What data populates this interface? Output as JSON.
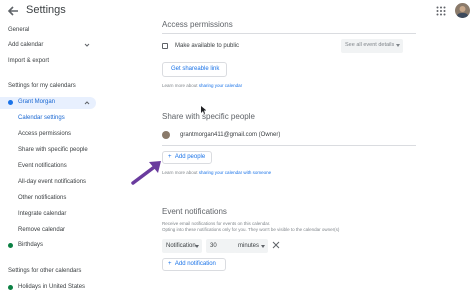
{
  "header": {
    "title": "Settings",
    "back_icon": "arrow-left-icon",
    "apps_icon": "apps-grid-icon"
  },
  "sidebar": {
    "items": [
      {
        "label": "General"
      },
      {
        "label": "Add calendar"
      },
      {
        "label": "Import & export"
      }
    ],
    "my_calendars_heading": "Settings for my calendars",
    "selected_calendar": "Grant Morgan",
    "selected_calendar_color": "#1a73e8",
    "sub_items": [
      {
        "label": "Calendar settings"
      },
      {
        "label": "Access permissions"
      },
      {
        "label": "Share with specific people"
      },
      {
        "label": "Event notifications"
      },
      {
        "label": "All-day event notifications"
      },
      {
        "label": "Other notifications"
      },
      {
        "label": "Integrate calendar"
      },
      {
        "label": "Remove calendar"
      }
    ],
    "birthdays": "Birthdays",
    "birthdays_color": "#0b8043",
    "other_calendars_heading": "Settings for other calendars",
    "holidays": "Holidays in United States",
    "holidays_color": "#0b8043"
  },
  "access_permissions": {
    "title": "Access permissions",
    "make_public_label": "Make available to public",
    "visibility_value": "See all event details",
    "shareable_link_button": "Get shareable link",
    "hint_prefix": "Learn more about",
    "hint_link": "sharing your calendar"
  },
  "share_people": {
    "title": "Share with specific people",
    "person": "grantmorgan411@gmail.com (Owner)",
    "add_people_button": "Add people",
    "hint_prefix": "Learn more about",
    "hint_link": "sharing your calendar with someone"
  },
  "event_notifications": {
    "title": "Event notifications",
    "desc_line1": "Receive email notifications for events on this calendar.",
    "desc_line2": "Opting into these notifications only for you. They won't be visible to the calendar owner(s)",
    "type_value": "Notification",
    "amount_value": "30",
    "unit_value": "minutes",
    "add_notification_button": "Add notification"
  },
  "colors": {
    "accent": "#1a73e8",
    "selected_bg": "#e8f0fe",
    "arrow": "#6a3b9e"
  }
}
